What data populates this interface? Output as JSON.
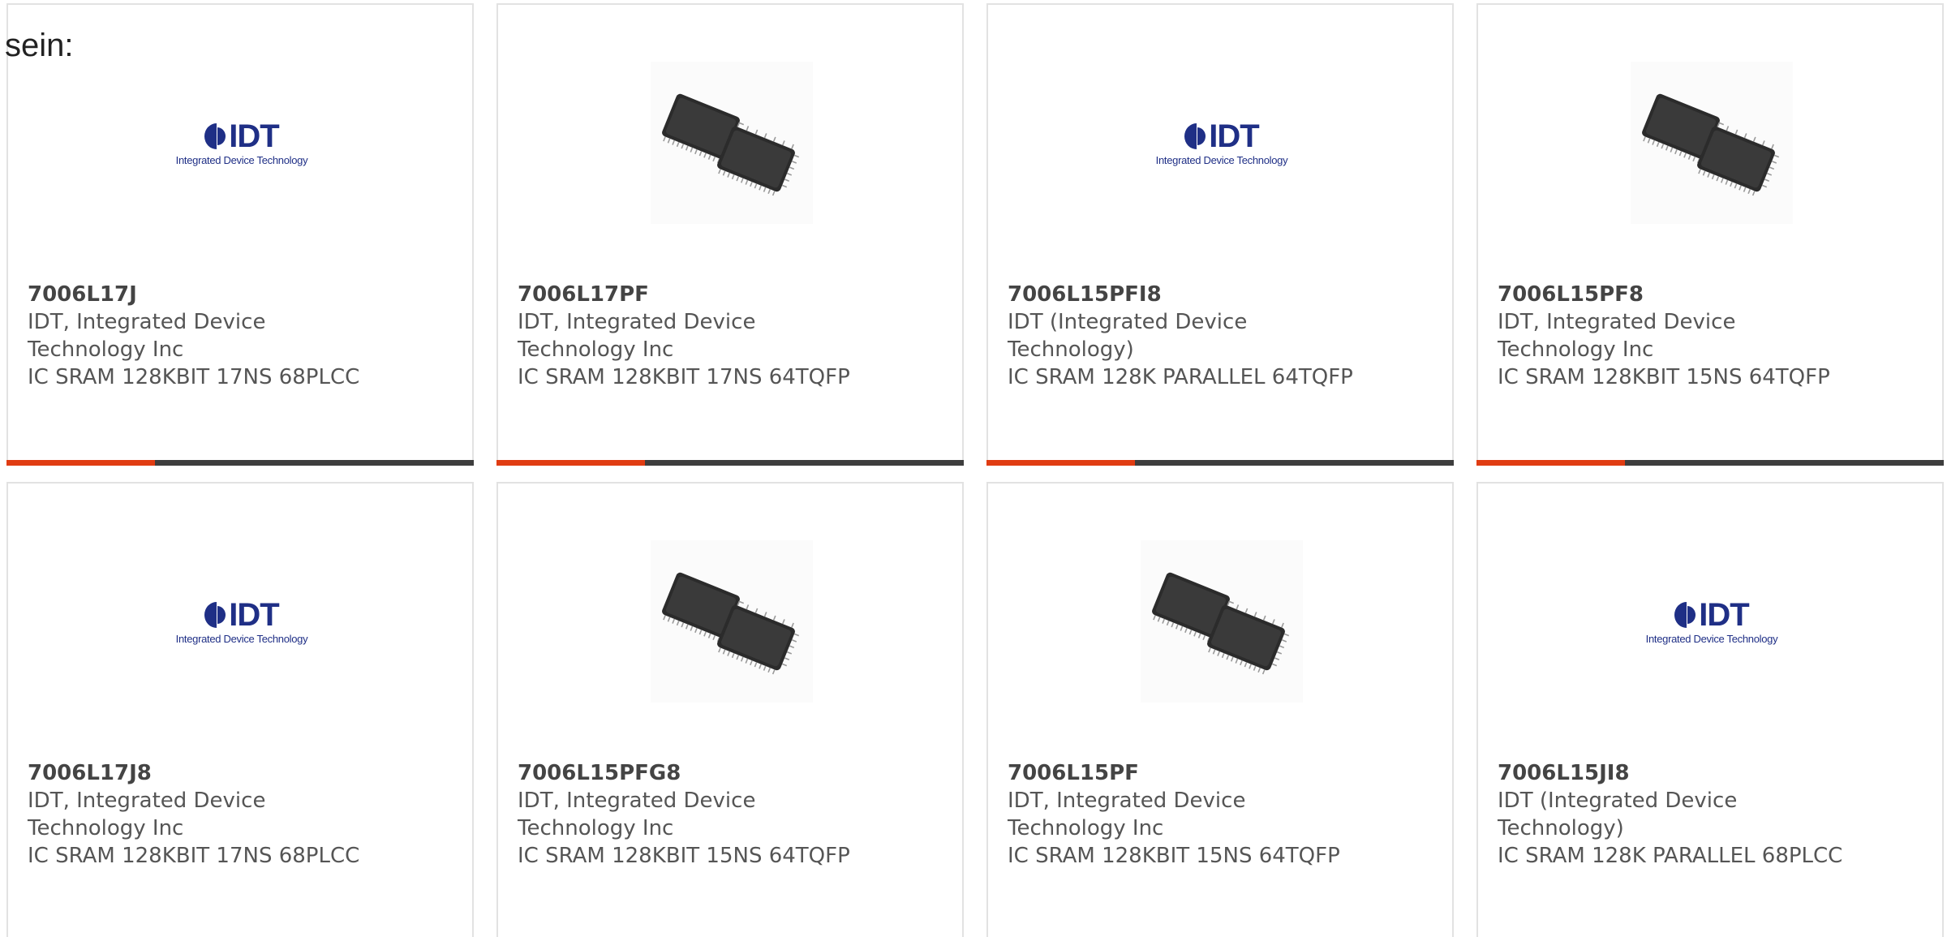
{
  "intro_text": "sein:",
  "colors": {
    "accent": "#e03c12",
    "bar_dark": "#3d3d3d",
    "logo_blue": "#1f2f86",
    "card_border": "#e2e2e2"
  },
  "logo": {
    "mark": "IDT",
    "tagline": "Integrated Device Technology"
  },
  "products": [
    {
      "part": "7006L17J",
      "manufacturer_line1": "IDT, Integrated Device",
      "manufacturer_line2": "Technology Inc",
      "description": "IC SRAM 128KBIT 17NS 68PLCC",
      "image": "idt-logo"
    },
    {
      "part": "7006L17PF",
      "manufacturer_line1": "IDT, Integrated Device",
      "manufacturer_line2": "Technology Inc",
      "description": "IC SRAM 128KBIT 17NS 64TQFP",
      "image": "tqfp-chips"
    },
    {
      "part": "7006L15PFI8",
      "manufacturer_line1": "IDT (Integrated Device",
      "manufacturer_line2": "Technology)",
      "description": "IC SRAM 128K PARALLEL 64TQFP",
      "image": "idt-logo"
    },
    {
      "part": "7006L15PF8",
      "manufacturer_line1": "IDT, Integrated Device",
      "manufacturer_line2": "Technology Inc",
      "description": "IC SRAM 128KBIT 15NS 64TQFP",
      "image": "tqfp-chips"
    },
    {
      "part": "7006L17J8",
      "manufacturer_line1": "IDT, Integrated Device",
      "manufacturer_line2": "Technology Inc",
      "description": "IC SRAM 128KBIT 17NS 68PLCC",
      "image": "idt-logo"
    },
    {
      "part": "7006L15PFG8",
      "manufacturer_line1": "IDT, Integrated Device",
      "manufacturer_line2": "Technology Inc",
      "description": "IC SRAM 128KBIT 15NS 64TQFP",
      "image": "tqfp-chips"
    },
    {
      "part": "7006L15PF",
      "manufacturer_line1": "IDT, Integrated Device",
      "manufacturer_line2": "Technology Inc",
      "description": "IC SRAM 128KBIT 15NS 64TQFP",
      "image": "tqfp-chips"
    },
    {
      "part": "7006L15JI8",
      "manufacturer_line1": "IDT (Integrated Device",
      "manufacturer_line2": "Technology)",
      "description": "IC SRAM 128K PARALLEL 68PLCC",
      "image": "idt-logo"
    }
  ]
}
